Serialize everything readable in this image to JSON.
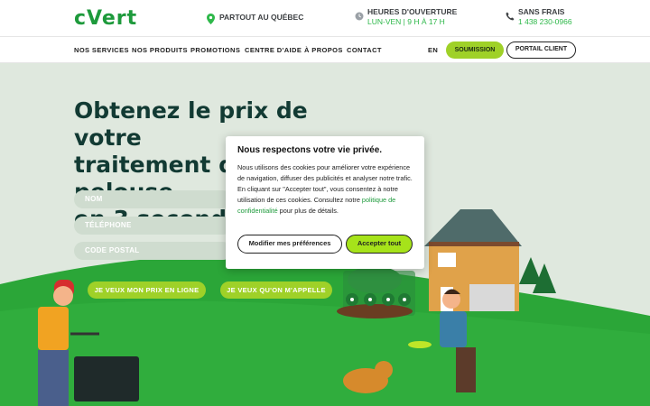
{
  "header": {
    "logo": "cVert",
    "location": {
      "label": "PARTOUT AU QUÉBEC"
    },
    "hours": {
      "label": "HEURES D'OUVERTURE",
      "value": "LUN-VEN | 9 H À 17 H"
    },
    "phone": {
      "label": "SANS FRAIS",
      "value": "1 438 230-0966"
    }
  },
  "nav": {
    "items": [
      "NOS SERVICES",
      "NOS PRODUITS",
      "PROMOTIONS",
      "CENTRE D'AIDE",
      "À PROPOS",
      "CONTACT"
    ],
    "lang": "EN",
    "submit": "SOUMISSION",
    "portal": "PORTAIL CLIENT"
  },
  "hero": {
    "title_line1": "Obtenez le prix de votre",
    "title_line2": "traitement de pelouse",
    "title_line3": "en 3 secondes",
    "fields": {
      "name": "NOM",
      "phone": "TÉLÉPHONE",
      "postal": "CODE POSTAL"
    },
    "cta_price": "JE VEUX MON PRIX EN LIGNE",
    "cta_call": "JE VEUX QU'ON M'APPELLE"
  },
  "cookie": {
    "title": "Nous respectons votre vie privée.",
    "text_before": "Nous utilisons des cookies pour améliorer votre expérience de navigation, diffuser des publicités et analyser notre trafic. En cliquant sur \"Accepter tout\", vous consentez à notre utilisation de ces cookies. Consultez notre ",
    "link": "politique de confidentialité",
    "text_after": " pour plus de détails.",
    "modify": "Modifier mes préférences",
    "accept": "Accepter tout"
  },
  "colors": {
    "brand_green": "#1e9a3c",
    "lime": "#9fd128",
    "title": "#123a33"
  }
}
